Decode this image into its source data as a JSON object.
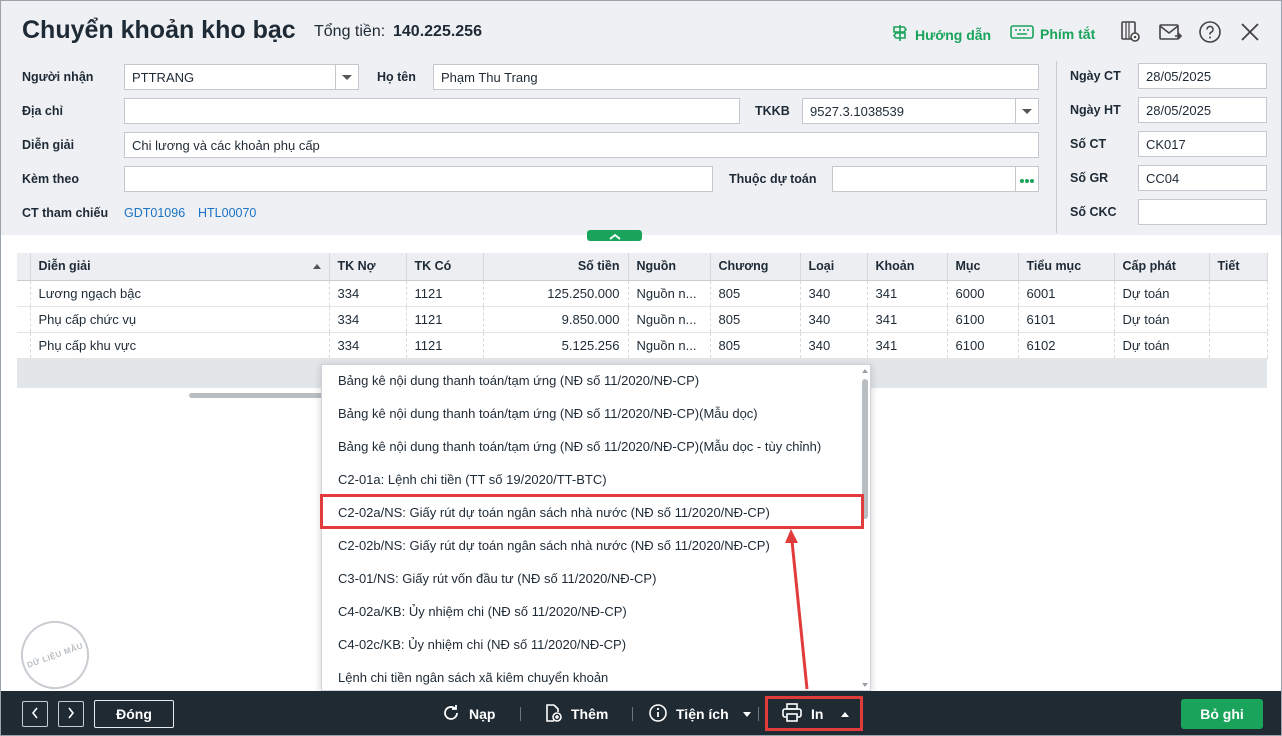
{
  "header": {
    "title": "Chuyển khoản kho bạc",
    "total_label": "Tổng tiền:",
    "total_value": "140.225.256",
    "guide_label": "Hướng dẫn",
    "shortcut_label": "Phím tắt",
    "icons": [
      "book-view-icon",
      "mail-icon",
      "help-icon",
      "close-icon"
    ]
  },
  "form": {
    "recipient_label": "Người nhận",
    "recipient_value": "PTTRANG",
    "fullname_label": "Họ tên",
    "fullname_value": "Phạm Thu Trang",
    "address_label": "Địa chỉ",
    "address_value": "",
    "tkkb_label": "TKKB",
    "tkkb_value": "9527.3.1038539",
    "description_label": "Diễn giải",
    "description_value": "Chi lương và các khoản phụ cấp",
    "attach_label": "Kèm theo",
    "attach_value": "",
    "budget_label": "Thuộc dự toán",
    "budget_value": "",
    "ref_label": "CT tham chiếu",
    "ref_links": [
      "GDT01096",
      "HTL00070"
    ],
    "date_ct_label": "Ngày CT",
    "date_ct_value": "28/05/2025",
    "date_ht_label": "Ngày HT",
    "date_ht_value": "28/05/2025",
    "so_ct_label": "Số CT",
    "so_ct_value": "CK017",
    "so_gr_label": "Số GR",
    "so_gr_value": "CC04",
    "so_ckc_label": "Số CKC",
    "so_ckc_value": ""
  },
  "grid": {
    "columns": [
      "Diễn giải",
      "TK Nợ",
      "TK Có",
      "Số tiền",
      "Nguồn",
      "Chương",
      "Loại",
      "Khoản",
      "Mục",
      "Tiểu mục",
      "Cấp phát",
      "Tiết"
    ],
    "rows": [
      [
        "Lương ngạch bậc",
        "334",
        "1121",
        "125.250.000",
        "Nguồn n...",
        "805",
        "340",
        "341",
        "6000",
        "6001",
        "Dự toán",
        ""
      ],
      [
        "Phụ cấp chức vụ",
        "334",
        "1121",
        "9.850.000",
        "Nguồn n...",
        "805",
        "340",
        "341",
        "6100",
        "6101",
        "Dự toán",
        ""
      ],
      [
        "Phụ cấp khu vực",
        "334",
        "1121",
        "5.125.256",
        "Nguồn n...",
        "805",
        "340",
        "341",
        "6100",
        "6102",
        "Dự toán",
        ""
      ]
    ]
  },
  "stamp_text": "DỮ LIỆU MẪU",
  "print_menu": {
    "items": [
      "Bảng kê nội dung thanh toán/tạm ứng (NĐ số 11/2020/NĐ-CP)",
      "Bảng kê nội dung thanh toán/tạm ứng (NĐ số 11/2020/NĐ-CP)(Mẫu dọc)",
      "Bảng kê nội dung thanh toán/tạm ứng (NĐ số 11/2020/NĐ-CP)(Mẫu dọc - tùy chỉnh)",
      "C2-01a: Lệnh chi tiền (TT số 19/2020/TT-BTC)",
      "C2-02a/NS: Giấy rút dự toán ngân sách nhà nước (NĐ số 11/2020/NĐ-CP)",
      "C2-02b/NS: Giấy rút dự toán ngân sách nhà nước (NĐ số 11/2020/NĐ-CP)",
      "C3-01/NS: Giấy rút vốn đầu tư (NĐ số 11/2020/NĐ-CP)",
      "C4-02a/KB: Ủy nhiệm chi (NĐ số 11/2020/NĐ-CP)",
      "C4-02c/KB: Ủy nhiệm chi (NĐ số 11/2020/NĐ-CP)",
      "Lệnh chi tiền ngân sách xã kiêm chuyển khoản"
    ],
    "highlighted_index": 4
  },
  "bottombar": {
    "close_label": "Đóng",
    "reload_label": "Nạp",
    "add_label": "Thêm",
    "utilities_label": "Tiện ích",
    "print_label": "In",
    "save_label": "Bỏ ghi"
  },
  "colors": {
    "accent": "#19a35b",
    "link": "#1a73c6",
    "highlight": "#e23b3b",
    "bottombar": "#1f2a33"
  }
}
